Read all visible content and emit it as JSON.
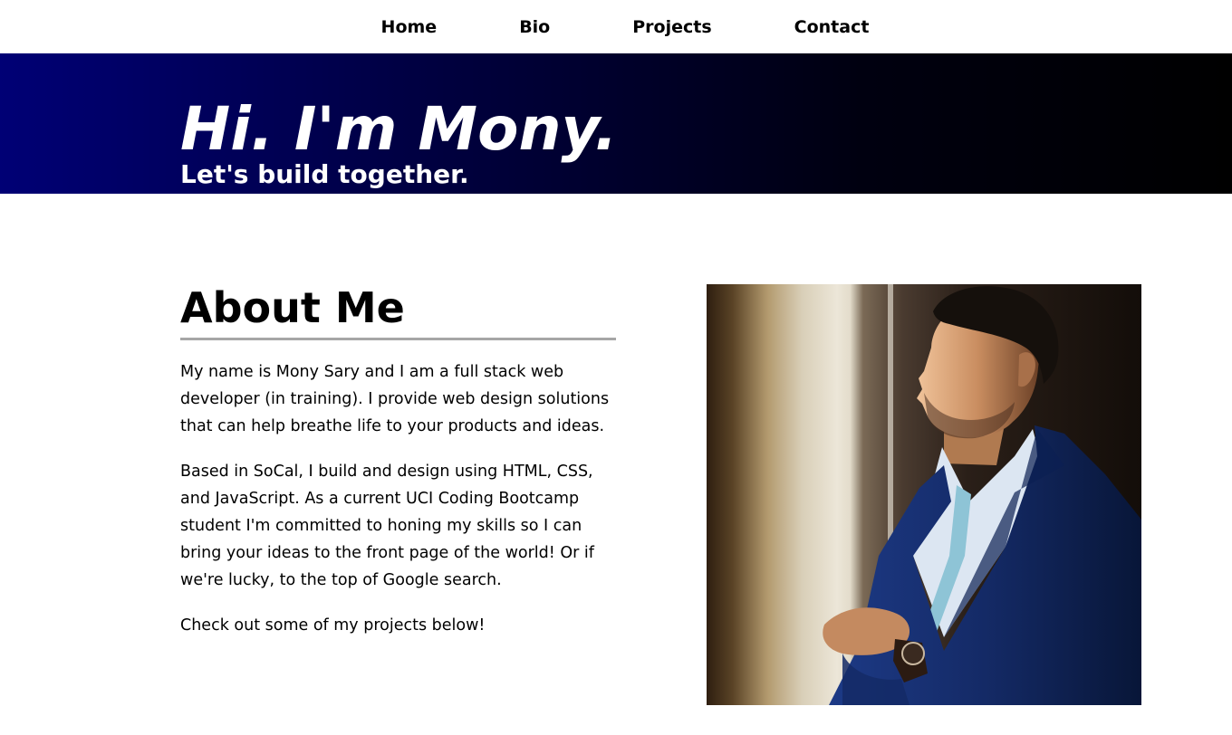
{
  "nav": {
    "items": [
      {
        "label": "Home"
      },
      {
        "label": "Bio"
      },
      {
        "label": "Projects"
      },
      {
        "label": "Contact"
      }
    ]
  },
  "hero": {
    "title": "Hi. I'm Mony.",
    "subtitle": "Let's build together."
  },
  "about": {
    "title": "About Me",
    "paragraphs": [
      "My name is Mony Sary and I am a full stack web developer (in training). I provide web design solutions that can help breathe life to your products and ideas.",
      "Based in SoCal, I build and design using HTML, CSS, and JavaScript. As a current UCI Coding Bootcamp student I'm committed to honing my skills so I can bring your ideas to the front page of the world! Or if we're lucky, to the top of Google search.",
      "Check out some of my projects below!"
    ]
  },
  "photo": {
    "alt": "profile-photo"
  },
  "colors": {
    "hero_gradient_start": "#000075",
    "hero_gradient_end": "#000000",
    "divider": "#a6a6a6",
    "suit": "#142a66",
    "tie": "#8ec4d6"
  }
}
